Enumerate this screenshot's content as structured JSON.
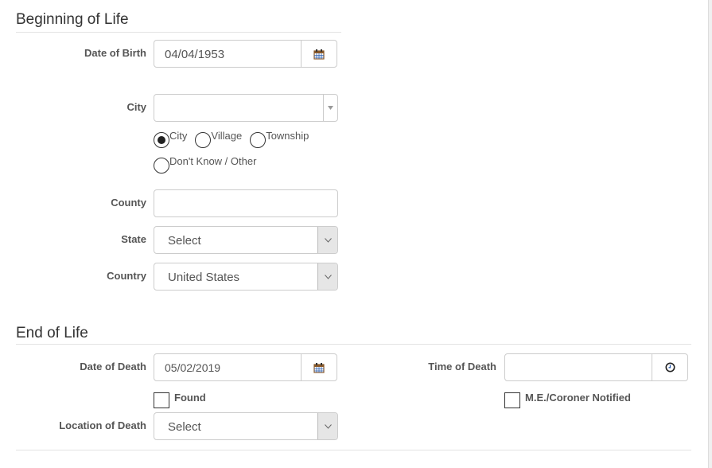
{
  "beginning": {
    "title": "Beginning of Life",
    "dob": {
      "label": "Date of Birth",
      "value": "04/04/1953",
      "icon": "calendar-icon"
    },
    "city": {
      "label": "City",
      "value": "",
      "icon": "caret-down-icon"
    },
    "place_type": {
      "options": [
        "City",
        "Village",
        "Township",
        "Don't Know / Other"
      ],
      "selected": "City"
    },
    "county": {
      "label": "County",
      "value": ""
    },
    "state": {
      "label": "State",
      "value": "Select"
    },
    "country": {
      "label": "Country",
      "value": "United States"
    }
  },
  "end": {
    "title": "End of Life",
    "dod": {
      "label": "Date of Death",
      "value": "05/02/2019",
      "icon": "calendar-icon"
    },
    "found": {
      "label": "Found",
      "checked": false
    },
    "location": {
      "label": "Location of Death",
      "value": "Select"
    },
    "tod": {
      "label": "Time of Death",
      "value": "",
      "icon": "clock-icon"
    },
    "coroner": {
      "label": "M.E./Coroner Notified",
      "checked": false
    }
  },
  "colors": {
    "icon_brown": "#8a5a2b",
    "icon_blue": "#2a5db0"
  }
}
